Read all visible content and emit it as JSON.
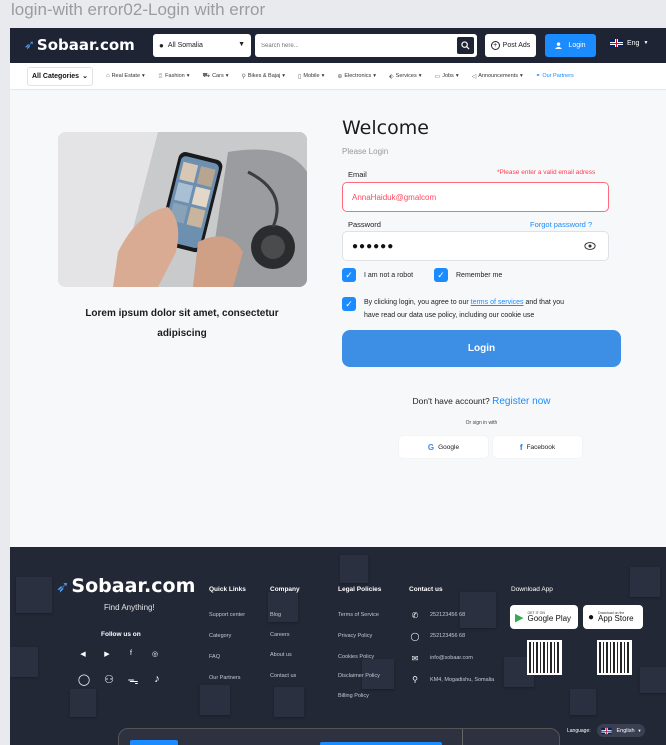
{
  "frame_title": "login-with error02-Login with error",
  "header": {
    "logo": "Sobaar.com",
    "location": "All Somalia",
    "search_placeholder": "Search here...",
    "post_ads": "Post Ads",
    "login": "Login",
    "language": "Eng"
  },
  "categories": {
    "all": "All Categories",
    "items": [
      "Real Estate",
      "Fashion",
      "Cars",
      "Bikes & Bajaj",
      "Mobile",
      "Electronics",
      "Services",
      "Jobs",
      "Announcements"
    ],
    "partners": "Our Partners"
  },
  "promo": {
    "caption": "Lorem ipsum dolor sit amet, consectetur adipiscing"
  },
  "form": {
    "title": "Welcome",
    "subtitle": "Please Login",
    "email_label": "Email",
    "email_error": "*Please enter a valid email adress",
    "email_value": "AnnaHaiduk@gmalcom",
    "password_label": "Password",
    "forgot": "Forgot password ?",
    "password_value": "●●●●●●",
    "robot": "I am not a robot",
    "remember": "Remember me",
    "terms_pre": "By clicking login, you agree to our",
    "terms_link": "terms of services",
    "terms_post": "and that you",
    "terms_line2": "have read our data use policy, including our cookie use",
    "login_button": "Login",
    "no_account": "Don't have account?",
    "register": "Register now",
    "or_sign_in": "Or sign in with",
    "google": "Google",
    "facebook": "Facebook"
  },
  "footer": {
    "logo": "Sobaar.com",
    "tagline": "Find Anything!",
    "follow": "Follow us on",
    "quick_links": {
      "title": "Quick Links",
      "items": [
        "Support center",
        "Category",
        "FAQ",
        "Our Partners"
      ]
    },
    "company": {
      "title": "Company",
      "items": [
        "Blog",
        "Careers",
        "About us",
        "Contact us"
      ]
    },
    "legal": {
      "title": "Legal Policies",
      "items": [
        "Terms of Service",
        "Privacy Policy",
        "Cookies Policy",
        "Disclaimer Policy",
        "Billing Policy"
      ]
    },
    "contact": {
      "title": "Contact us",
      "items": [
        "252123456 68",
        "252123456 68",
        "info@sobaar.com",
        "KM4, Mogadishu, Somalia"
      ]
    },
    "download": {
      "title": "Download App",
      "google_small": "GET IT ON",
      "google_big": "Google Play",
      "apple_small": "Download on the",
      "apple_big": "App Store"
    },
    "language_label": "Language:",
    "language_value": "English"
  }
}
